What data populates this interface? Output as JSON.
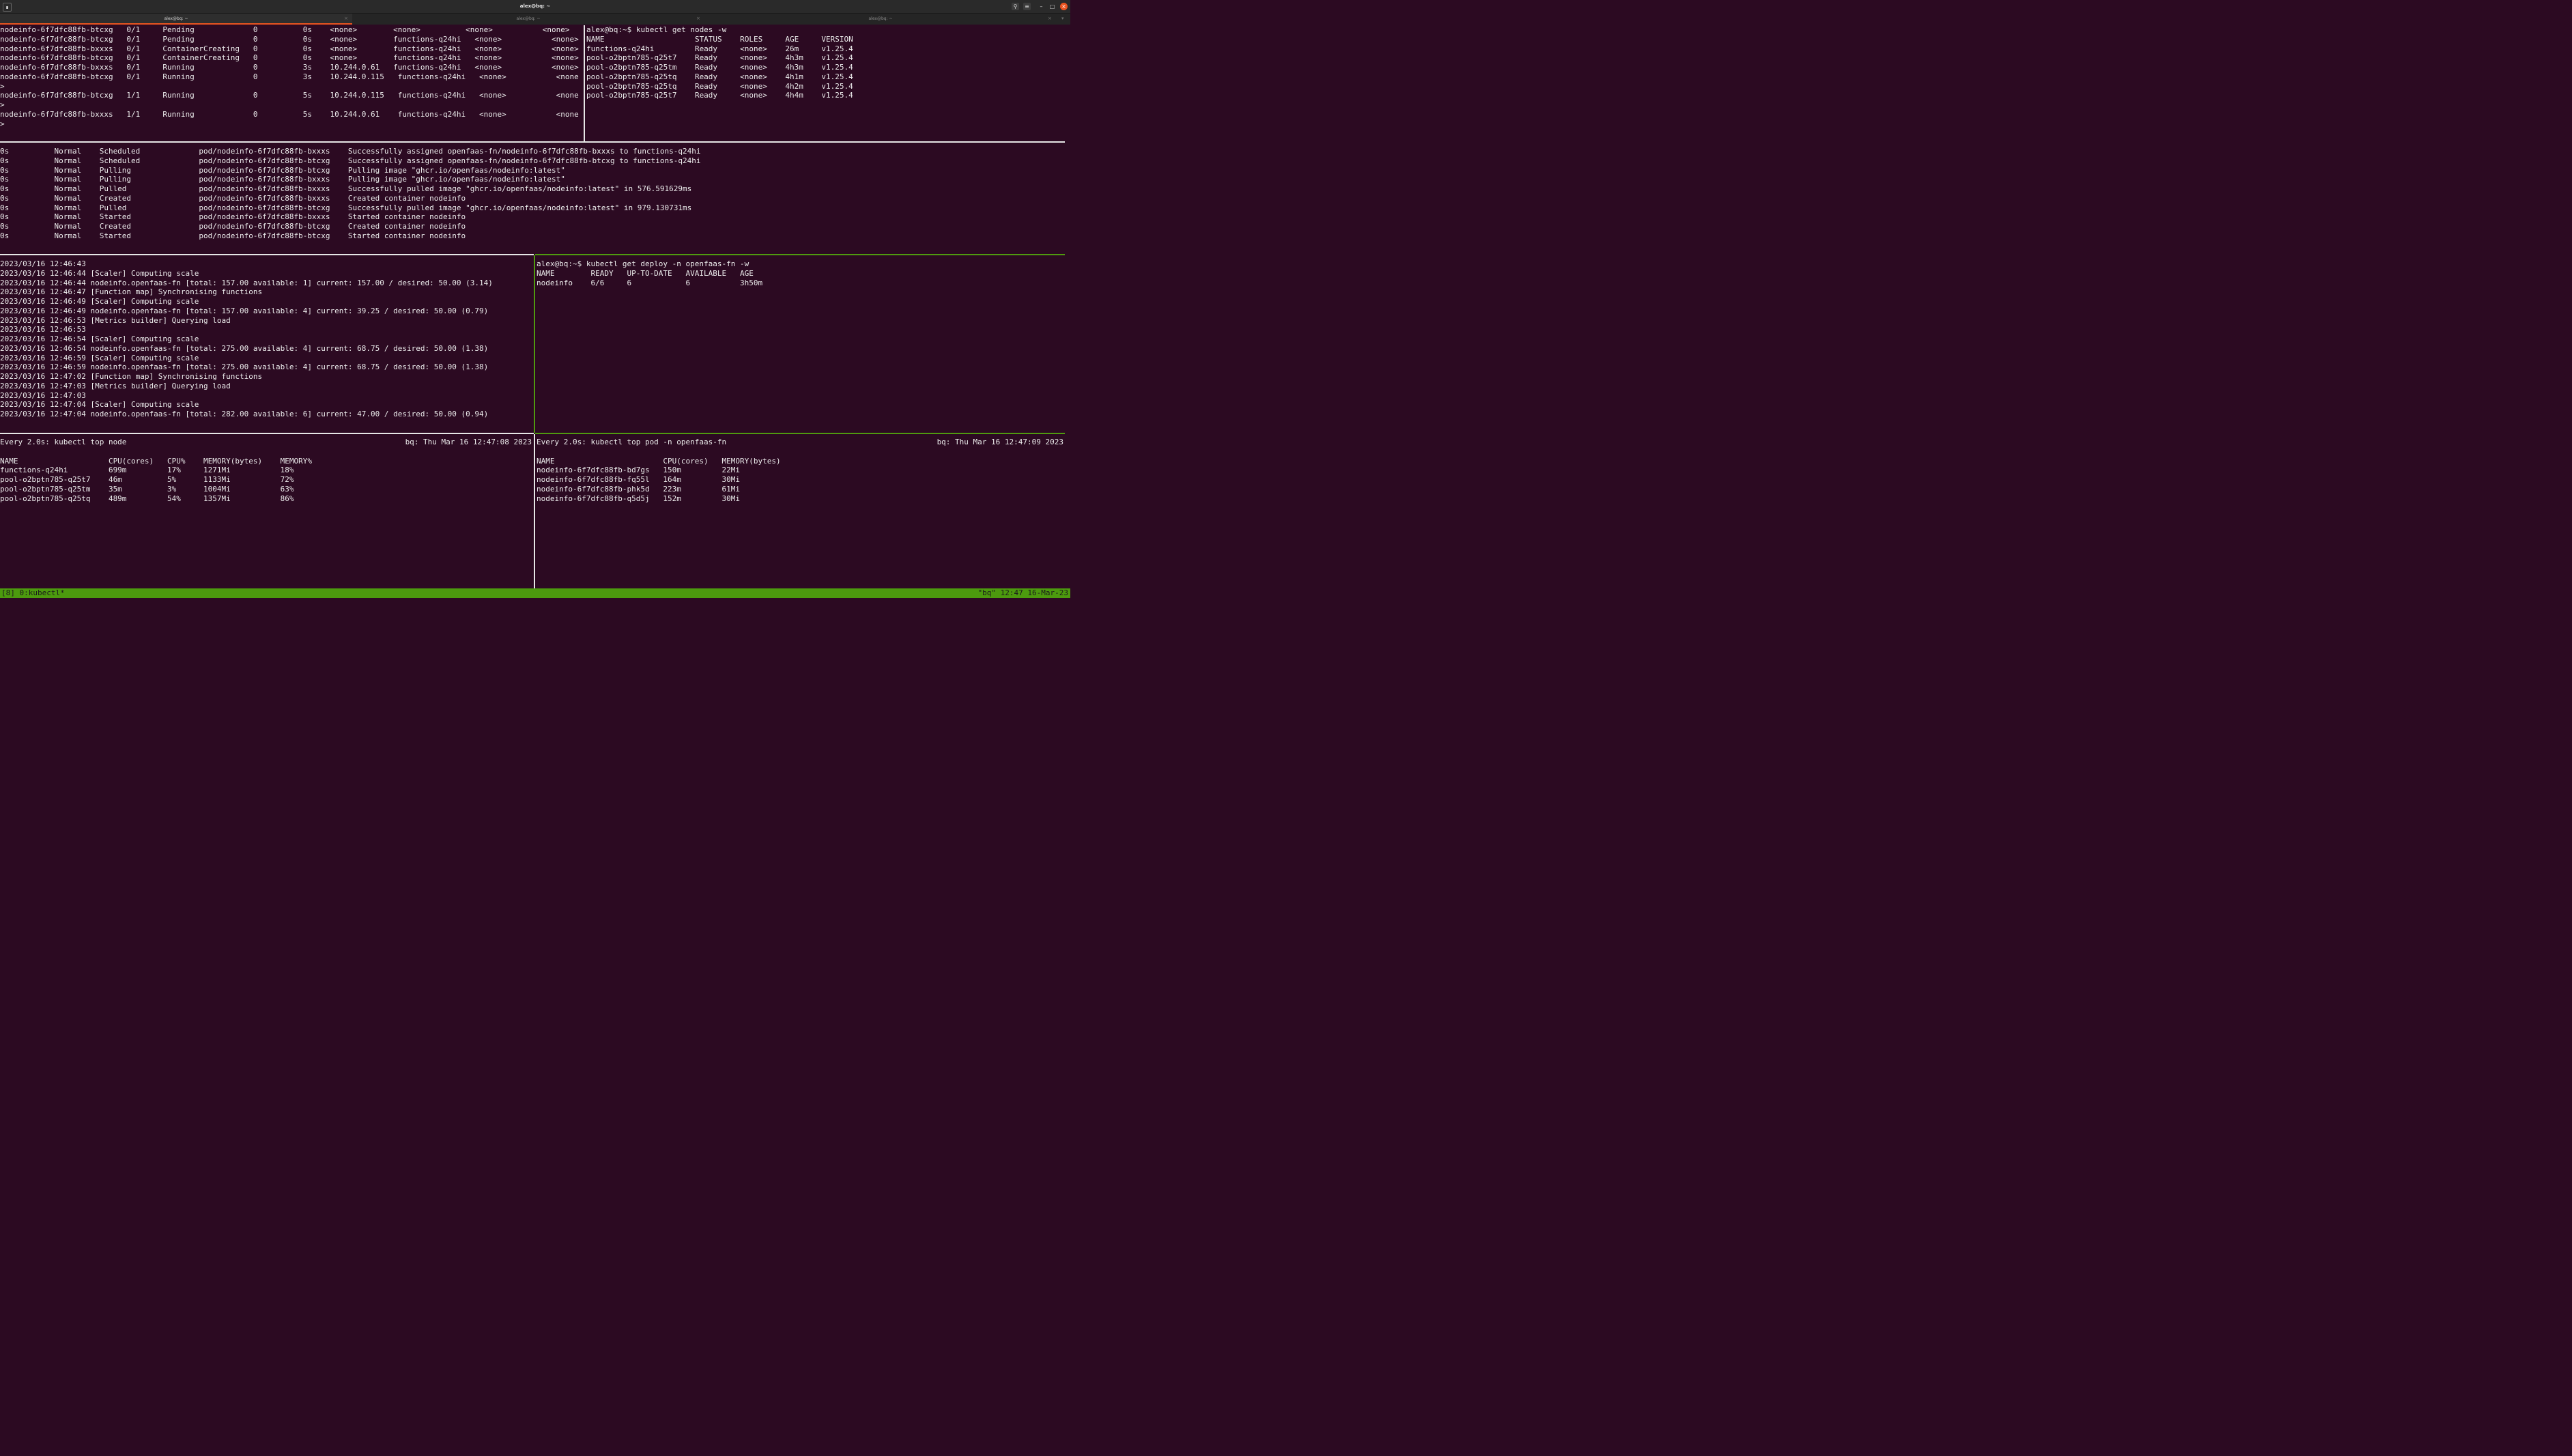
{
  "window": {
    "title": "alex@bq: ~",
    "tabs": [
      {
        "label": "alex@bq: ~",
        "active": true
      },
      {
        "label": "alex@bq: ~",
        "active": false
      },
      {
        "label": "alex@bq: ~",
        "active": false
      }
    ],
    "icons": {
      "app": "terminal-icon",
      "search": "search-icon",
      "menu": "hamburger-icon",
      "minimize": "minimize-icon",
      "maximize": "maximize-icon",
      "close": "close-icon"
    },
    "close_color": "#e95420"
  },
  "panes": {
    "pods_watch": "nodeinfo-6f7dfc88fb-btcxg   0/1     Pending             0          0s    <none>        <none>          <none>           <none>\nnodeinfo-6f7dfc88fb-btcxg   0/1     Pending             0          0s    <none>        functions-q24hi   <none>           <none>\nnodeinfo-6f7dfc88fb-bxxxs   0/1     ContainerCreating   0          0s    <none>        functions-q24hi   <none>           <none>\nnodeinfo-6f7dfc88fb-btcxg   0/1     ContainerCreating   0          0s    <none>        functions-q24hi   <none>           <none>\nnodeinfo-6f7dfc88fb-bxxxs   0/1     Running             0          3s    10.244.0.61   functions-q24hi   <none>           <none>\nnodeinfo-6f7dfc88fb-btcxg   0/1     Running             0          3s    10.244.0.115   functions-q24hi   <none>           <none\n>\nnodeinfo-6f7dfc88fb-btcxg   1/1     Running             0          5s    10.244.0.115   functions-q24hi   <none>           <none\n>\nnodeinfo-6f7dfc88fb-bxxxs   1/1     Running             0          5s    10.244.0.61    functions-q24hi   <none>           <none\n>",
    "nodes_watch": "alex@bq:~$ kubectl get nodes -w\nNAME                    STATUS    ROLES     AGE     VERSION\nfunctions-q24hi         Ready     <none>    26m     v1.25.4\npool-o2bptn785-q25t7    Ready     <none>    4h3m    v1.25.4\npool-o2bptn785-q25tm    Ready     <none>    4h3m    v1.25.4\npool-o2bptn785-q25tq    Ready     <none>    4h1m    v1.25.4\npool-o2bptn785-q25tq    Ready     <none>    4h2m    v1.25.4\npool-o2bptn785-q25t7    Ready     <none>    4h4m    v1.25.4",
    "events": "0s          Normal    Scheduled             pod/nodeinfo-6f7dfc88fb-bxxxs    Successfully assigned openfaas-fn/nodeinfo-6f7dfc88fb-bxxxs to functions-q24hi\n0s          Normal    Scheduled             pod/nodeinfo-6f7dfc88fb-btcxg    Successfully assigned openfaas-fn/nodeinfo-6f7dfc88fb-btcxg to functions-q24hi\n0s          Normal    Pulling               pod/nodeinfo-6f7dfc88fb-btcxg    Pulling image \"ghcr.io/openfaas/nodeinfo:latest\"\n0s          Normal    Pulling               pod/nodeinfo-6f7dfc88fb-bxxxs    Pulling image \"ghcr.io/openfaas/nodeinfo:latest\"\n0s          Normal    Pulled                pod/nodeinfo-6f7dfc88fb-bxxxs    Successfully pulled image \"ghcr.io/openfaas/nodeinfo:latest\" in 576.591629ms\n0s          Normal    Created               pod/nodeinfo-6f7dfc88fb-bxxxs    Created container nodeinfo\n0s          Normal    Pulled                pod/nodeinfo-6f7dfc88fb-btcxg    Successfully pulled image \"ghcr.io/openfaas/nodeinfo:latest\" in 979.130731ms\n0s          Normal    Started               pod/nodeinfo-6f7dfc88fb-bxxxs    Started container nodeinfo\n0s          Normal    Created               pod/nodeinfo-6f7dfc88fb-btcxg    Created container nodeinfo\n0s          Normal    Started               pod/nodeinfo-6f7dfc88fb-btcxg    Started container nodeinfo",
    "scaler_log": "2023/03/16 12:46:43\n2023/03/16 12:46:44 [Scaler] Computing scale\n2023/03/16 12:46:44 nodeinfo.openfaas-fn [total: 157.00 available: 1] current: 157.00 / desired: 50.00 (3.14)\n2023/03/16 12:46:47 [Function map] Synchronising functions\n2023/03/16 12:46:49 [Scaler] Computing scale\n2023/03/16 12:46:49 nodeinfo.openfaas-fn [total: 157.00 available: 4] current: 39.25 / desired: 50.00 (0.79)\n2023/03/16 12:46:53 [Metrics builder] Querying load\n2023/03/16 12:46:53\n2023/03/16 12:46:54 [Scaler] Computing scale\n2023/03/16 12:46:54 nodeinfo.openfaas-fn [total: 275.00 available: 4] current: 68.75 / desired: 50.00 (1.38)\n2023/03/16 12:46:59 [Scaler] Computing scale\n2023/03/16 12:46:59 nodeinfo.openfaas-fn [total: 275.00 available: 4] current: 68.75 / desired: 50.00 (1.38)\n2023/03/16 12:47:02 [Function map] Synchronising functions\n2023/03/16 12:47:03 [Metrics builder] Querying load\n2023/03/16 12:47:03\n2023/03/16 12:47:04 [Scaler] Computing scale\n2023/03/16 12:47:04 nodeinfo.openfaas-fn [total: 282.00 available: 6] current: 47.00 / desired: 50.00 (0.94)",
    "deploy_watch": "alex@bq:~$ kubectl get deploy -n openfaas-fn -w\nNAME        READY   UP-TO-DATE   AVAILABLE   AGE\nnodeinfo    6/6     6            6           3h50m",
    "top_node": {
      "header_left": "Every 2.0s: kubectl top node",
      "header_right": "bq: Thu Mar 16 12:47:08 2023",
      "table": "NAME                    CPU(cores)   CPU%    MEMORY(bytes)    MEMORY%\nfunctions-q24hi         699m         17%     1271Mi           18%\npool-o2bptn785-q25t7    46m          5%      1133Mi           72%\npool-o2bptn785-q25tm    35m          3%      1004Mi           63%\npool-o2bptn785-q25tq    489m         54%     1357Mi           86%"
    },
    "top_pod": {
      "header_left": "Every 2.0s: kubectl top pod -n openfaas-fn",
      "header_right": "bq: Thu Mar 16 12:47:09 2023",
      "table": "NAME                        CPU(cores)   MEMORY(bytes)\nnodeinfo-6f7dfc88fb-bd7gs   150m         22Mi\nnodeinfo-6f7dfc88fb-fq55l   164m         30Mi\nnodeinfo-6f7dfc88fb-phk5d   223m         61Mi\nnodeinfo-6f7dfc88fb-q5d5j   152m         30Mi"
    }
  },
  "status_bar": {
    "left": "[8] 0:kubectl*",
    "right": "\"bq\" 12:47 16-Mar-23",
    "color": "#4c9a0e"
  },
  "colors": {
    "background": "#2c0a22",
    "text": "#ececec",
    "active_pane_border": "#4f9a0f"
  }
}
